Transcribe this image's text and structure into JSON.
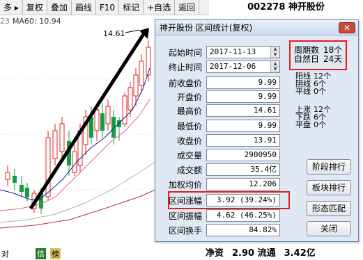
{
  "toolbar": {
    "items": [
      {
        "label": "多 ▸"
      },
      {
        "label": "复权"
      },
      {
        "label": "叠加"
      },
      {
        "label": "画线"
      },
      {
        "label": "F10"
      },
      {
        "label": "标记"
      },
      {
        "label": "+自选"
      },
      {
        "label": "返回"
      }
    ]
  },
  "header": {
    "stock": "002278 神开股份"
  },
  "ma": {
    "prefix": "23",
    "label": "MA60: 10.94"
  },
  "chart": {
    "high_label": "14.61"
  },
  "bottom": {
    "items": [
      "对",
      "信",
      "榜"
    ]
  },
  "dialog": {
    "title": "神开股份 区间统计(复权)",
    "close_label": "✕",
    "start": {
      "label": "起始时间",
      "value": "2017-11-13"
    },
    "end": {
      "label": "终止时间",
      "value": "2017-12-06"
    },
    "fields": [
      {
        "label": "前收盘价",
        "value": "9.99"
      },
      {
        "label": "开盘价",
        "value": "9.99"
      },
      {
        "label": "最高价",
        "value": "14.61"
      },
      {
        "label": "最低价",
        "value": "9.99"
      },
      {
        "label": "收盘价",
        "value": "13.91"
      },
      {
        "label": "成交量",
        "value": "2900950"
      },
      {
        "label": "成交额",
        "value": "35.4亿"
      },
      {
        "label": "加权均价",
        "value": "12.206"
      },
      {
        "label": "区间涨幅",
        "value": "3.92 (39.24%)"
      },
      {
        "label": "区间振幅",
        "value": "4.62 (46.25%)"
      },
      {
        "label": "区间换手",
        "value": "84.82%"
      }
    ],
    "period": [
      {
        "k": "周期数",
        "v": "18个"
      },
      {
        "k": "自然日",
        "v": "24天"
      }
    ],
    "kline": [
      {
        "k": "阳线",
        "v": "12个"
      },
      {
        "k": "阴线",
        "v": "6个"
      },
      {
        "k": "平线",
        "v": "0个"
      }
    ],
    "trend": [
      {
        "k": "上涨",
        "v": "12个"
      },
      {
        "k": "下跌",
        "v": "6个"
      },
      {
        "k": "平盘",
        "v": "0个"
      }
    ],
    "buttons": {
      "rank": "阶段排行",
      "sector": "板块排行",
      "pattern": "形态匹配",
      "close": "关闭"
    }
  },
  "under": {
    "a": "净资",
    "b": "2.90 流通",
    "c": "3.42亿"
  },
  "colors": {
    "up": "#e02020",
    "down": "#10a040",
    "ma_blue": "#1a1a8a",
    "ma_pink": "#e060a0",
    "arrow": "#000000"
  }
}
